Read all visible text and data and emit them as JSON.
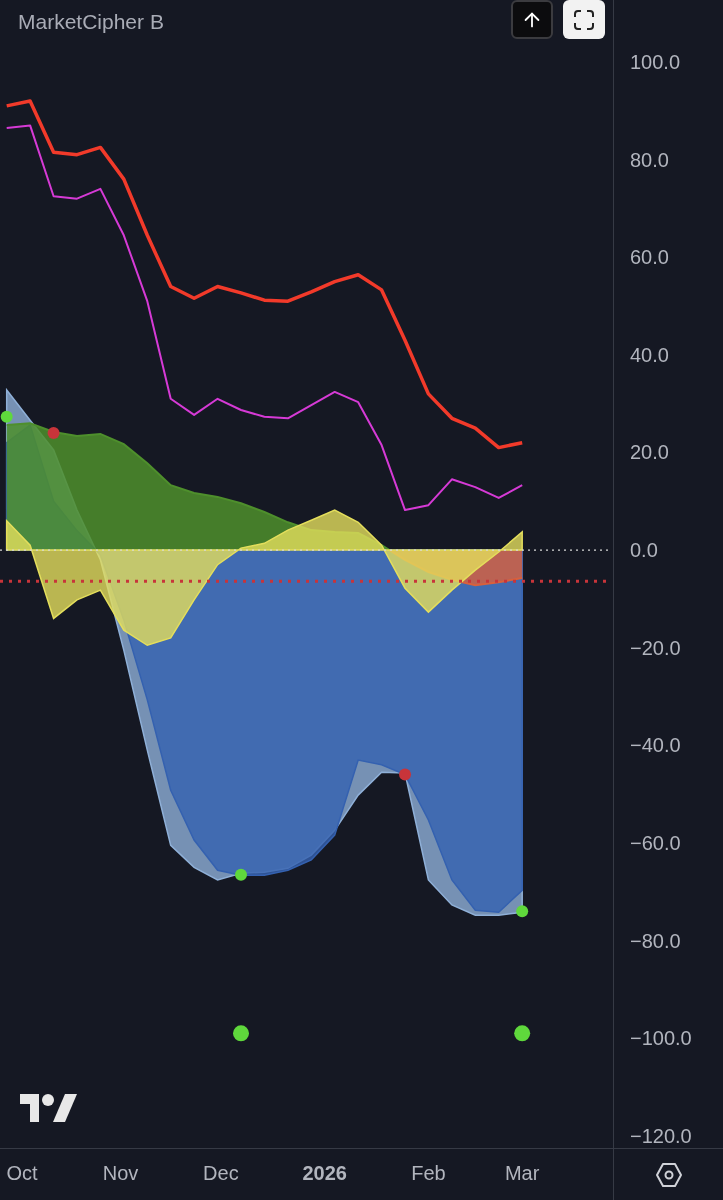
{
  "indicator": {
    "title": "MarketCipher B"
  },
  "toolbar": [
    {
      "kind": "arrow-up",
      "selected": false
    },
    {
      "kind": "fit",
      "selected": true
    }
  ],
  "chart": {
    "chart_data": {
      "type": "line",
      "x": [
        "2025-09-28",
        "2025-10-05",
        "2025-10-12",
        "2025-10-19",
        "2025-10-26",
        "2025-11-02",
        "2025-11-09",
        "2025-11-16",
        "2025-11-23",
        "2025-11-30",
        "2025-12-07",
        "2025-12-14",
        "2025-12-21",
        "2025-12-28",
        "2026-01-04",
        "2026-01-11",
        "2026-01-18",
        "2026-01-25",
        "2026-02-01",
        "2026-02-08",
        "2026-02-15",
        "2026-02-22",
        "2026-03-01"
      ],
      "xlim": [
        "2025-09-26",
        "2026-04-30"
      ],
      "ylim": [
        -122.5,
        112.7
      ],
      "xticks": [
        {
          "value": "2025-10-01",
          "label": "Oct"
        },
        {
          "value": "2025-11-01",
          "label": "Nov"
        },
        {
          "value": "2025-12-01",
          "label": "Dec"
        },
        {
          "value": "2026-01-01",
          "label": "2026"
        },
        {
          "value": "2026-02-01",
          "label": "Feb"
        },
        {
          "value": "2026-03-01",
          "label": "Mar"
        }
      ],
      "yticks": [
        {
          "value": 100,
          "label": "100.0"
        },
        {
          "value": 80,
          "label": "80.0"
        },
        {
          "value": 60,
          "label": "60.0"
        },
        {
          "value": 40,
          "label": "40.0"
        },
        {
          "value": 20,
          "label": "20.0"
        },
        {
          "value": 0,
          "label": "0.0"
        },
        {
          "value": -20,
          "label": "−20.0"
        },
        {
          "value": -40,
          "label": "−40.0"
        },
        {
          "value": -60,
          "label": "−60.0"
        },
        {
          "value": -80,
          "label": "−80.0"
        },
        {
          "value": -100,
          "label": "−100.0"
        },
        {
          "value": -120,
          "label": "−120.0"
        }
      ],
      "series": [
        {
          "type": "area",
          "color": "#8fb0d8",
          "values": [
            32.8,
            26.6,
            20.5,
            8.2,
            -2,
            -20.5,
            -41,
            -60.5,
            -65,
            -67.6,
            -66.2,
            -66,
            -65.2,
            -62.5,
            -57.4,
            -50.2,
            -45.5,
            -45.7,
            -67.6,
            -72.7,
            -74.8,
            -74.8,
            -74.2
          ]
        },
        {
          "type": "area",
          "color": "#3461b0",
          "values": [
            22,
            25.6,
            10,
            4,
            -1,
            -14.3,
            -30.7,
            -49.2,
            -59.4,
            -65.6,
            -66.6,
            -66.6,
            -65.6,
            -63.5,
            -58.4,
            -43,
            -44,
            -46,
            -55.3,
            -67.6,
            -73.8,
            -74.2,
            -69.7
          ]
        },
        {
          "type": "area",
          "color": "#4e8f2c",
          "values": [
            25.6,
            26,
            24.2,
            23.4,
            23.8,
            21.7,
            17.8,
            13.3,
            11.7,
            10.9,
            9.6,
            7.8,
            5.7,
            4.1,
            3.7,
            3.5,
            1,
            -2,
            -4.5,
            -6.1,
            -7.2,
            -6.6,
            -5.7
          ]
        },
        {
          "type": "area",
          "color": "#e4de5c",
          "values": [
            6,
            1,
            -14,
            -10.2,
            -8.2,
            -16.4,
            -19.5,
            -18,
            -10.2,
            -3,
            0.4,
            1.4,
            4.1,
            6.1,
            8.2,
            5.7,
            1,
            -7.8,
            -12.7,
            -8.2,
            -4.1,
            -0.4,
            3.7
          ]
        },
        {
          "type": "line",
          "color": "#f23a2a",
          "values": [
            91,
            92,
            81.5,
            81,
            82.5,
            76,
            64.5,
            54,
            51.6,
            54,
            52.7,
            51.2,
            51,
            52.9,
            55,
            56.4,
            53.3,
            43,
            32,
            27,
            25,
            21,
            22
          ]
        },
        {
          "type": "line",
          "color": "#d63ad6",
          "values": [
            86.5,
            87,
            72.5,
            72,
            74,
            64.5,
            51,
            31,
            27.7,
            31,
            28.7,
            27.3,
            27,
            29.7,
            32.4,
            30.3,
            21.5,
            8.2,
            9.2,
            14.5,
            12.9,
            10.7,
            13.3
          ]
        },
        {
          "type": "scatter",
          "color": "#5fd83c",
          "values": [
            27.3,
            null,
            null,
            null,
            null,
            null,
            null,
            null,
            null,
            null,
            -66.5,
            null,
            null,
            null,
            null,
            null,
            null,
            null,
            null,
            null,
            null,
            null,
            -74
          ]
        },
        {
          "type": "scatter",
          "color": "#5fd83c",
          "values": [
            null,
            null,
            null,
            null,
            null,
            null,
            null,
            null,
            null,
            null,
            -99,
            null,
            null,
            null,
            null,
            null,
            null,
            null,
            null,
            null,
            null,
            null,
            -99
          ]
        },
        {
          "type": "scatter",
          "color": "#c8343a",
          "values": [
            null,
            null,
            24,
            null,
            null,
            null,
            null,
            null,
            null,
            null,
            null,
            null,
            null,
            null,
            null,
            null,
            null,
            -46,
            null,
            null,
            null,
            null,
            null
          ]
        }
      ],
      "ref_lines": [
        {
          "axis": "y",
          "value": 0,
          "color": "#d8d8d8"
        },
        {
          "axis": "y",
          "value": -6.4,
          "color": "#c8343a"
        }
      ]
    }
  }
}
